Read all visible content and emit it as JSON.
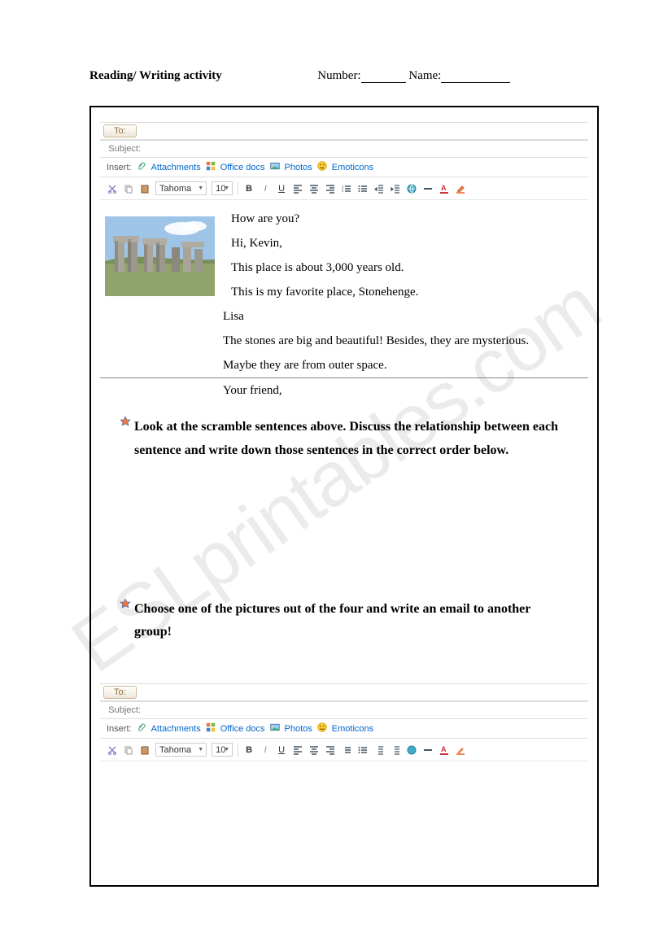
{
  "header": {
    "title": "Reading/ Writing activity",
    "num_label": "Number:",
    "name_label": "Name:"
  },
  "email": {
    "to_btn": "To:",
    "subject_label": "Subject:",
    "insert_label": "Insert:",
    "attachments": "Attachments",
    "office_docs": "Office docs",
    "photos": "Photos",
    "emoticons": "Emoticons",
    "font_name": "Tahoma",
    "font_size": "10",
    "bold": "B",
    "italic": "I",
    "underline": "U"
  },
  "scramble": {
    "l1": "How are you?",
    "l2": "Hi, Kevin,",
    "l3": "This place is about 3,000 years old.",
    "l4": "This is my favorite place, Stonehenge.",
    "l5": "Lisa",
    "l6": "The stones are big and beautiful! Besides, they are mysterious.",
    "l7": "Maybe they are from outer space.",
    "l8": "Your friend,"
  },
  "task1": "Look at the scramble sentences above. Discuss the relationship between each sentence and write down those sentences in the correct order below.",
  "task2": "Choose one of the pictures out of the four and write an email to another group!",
  "watermark": "ESLprintables.com"
}
